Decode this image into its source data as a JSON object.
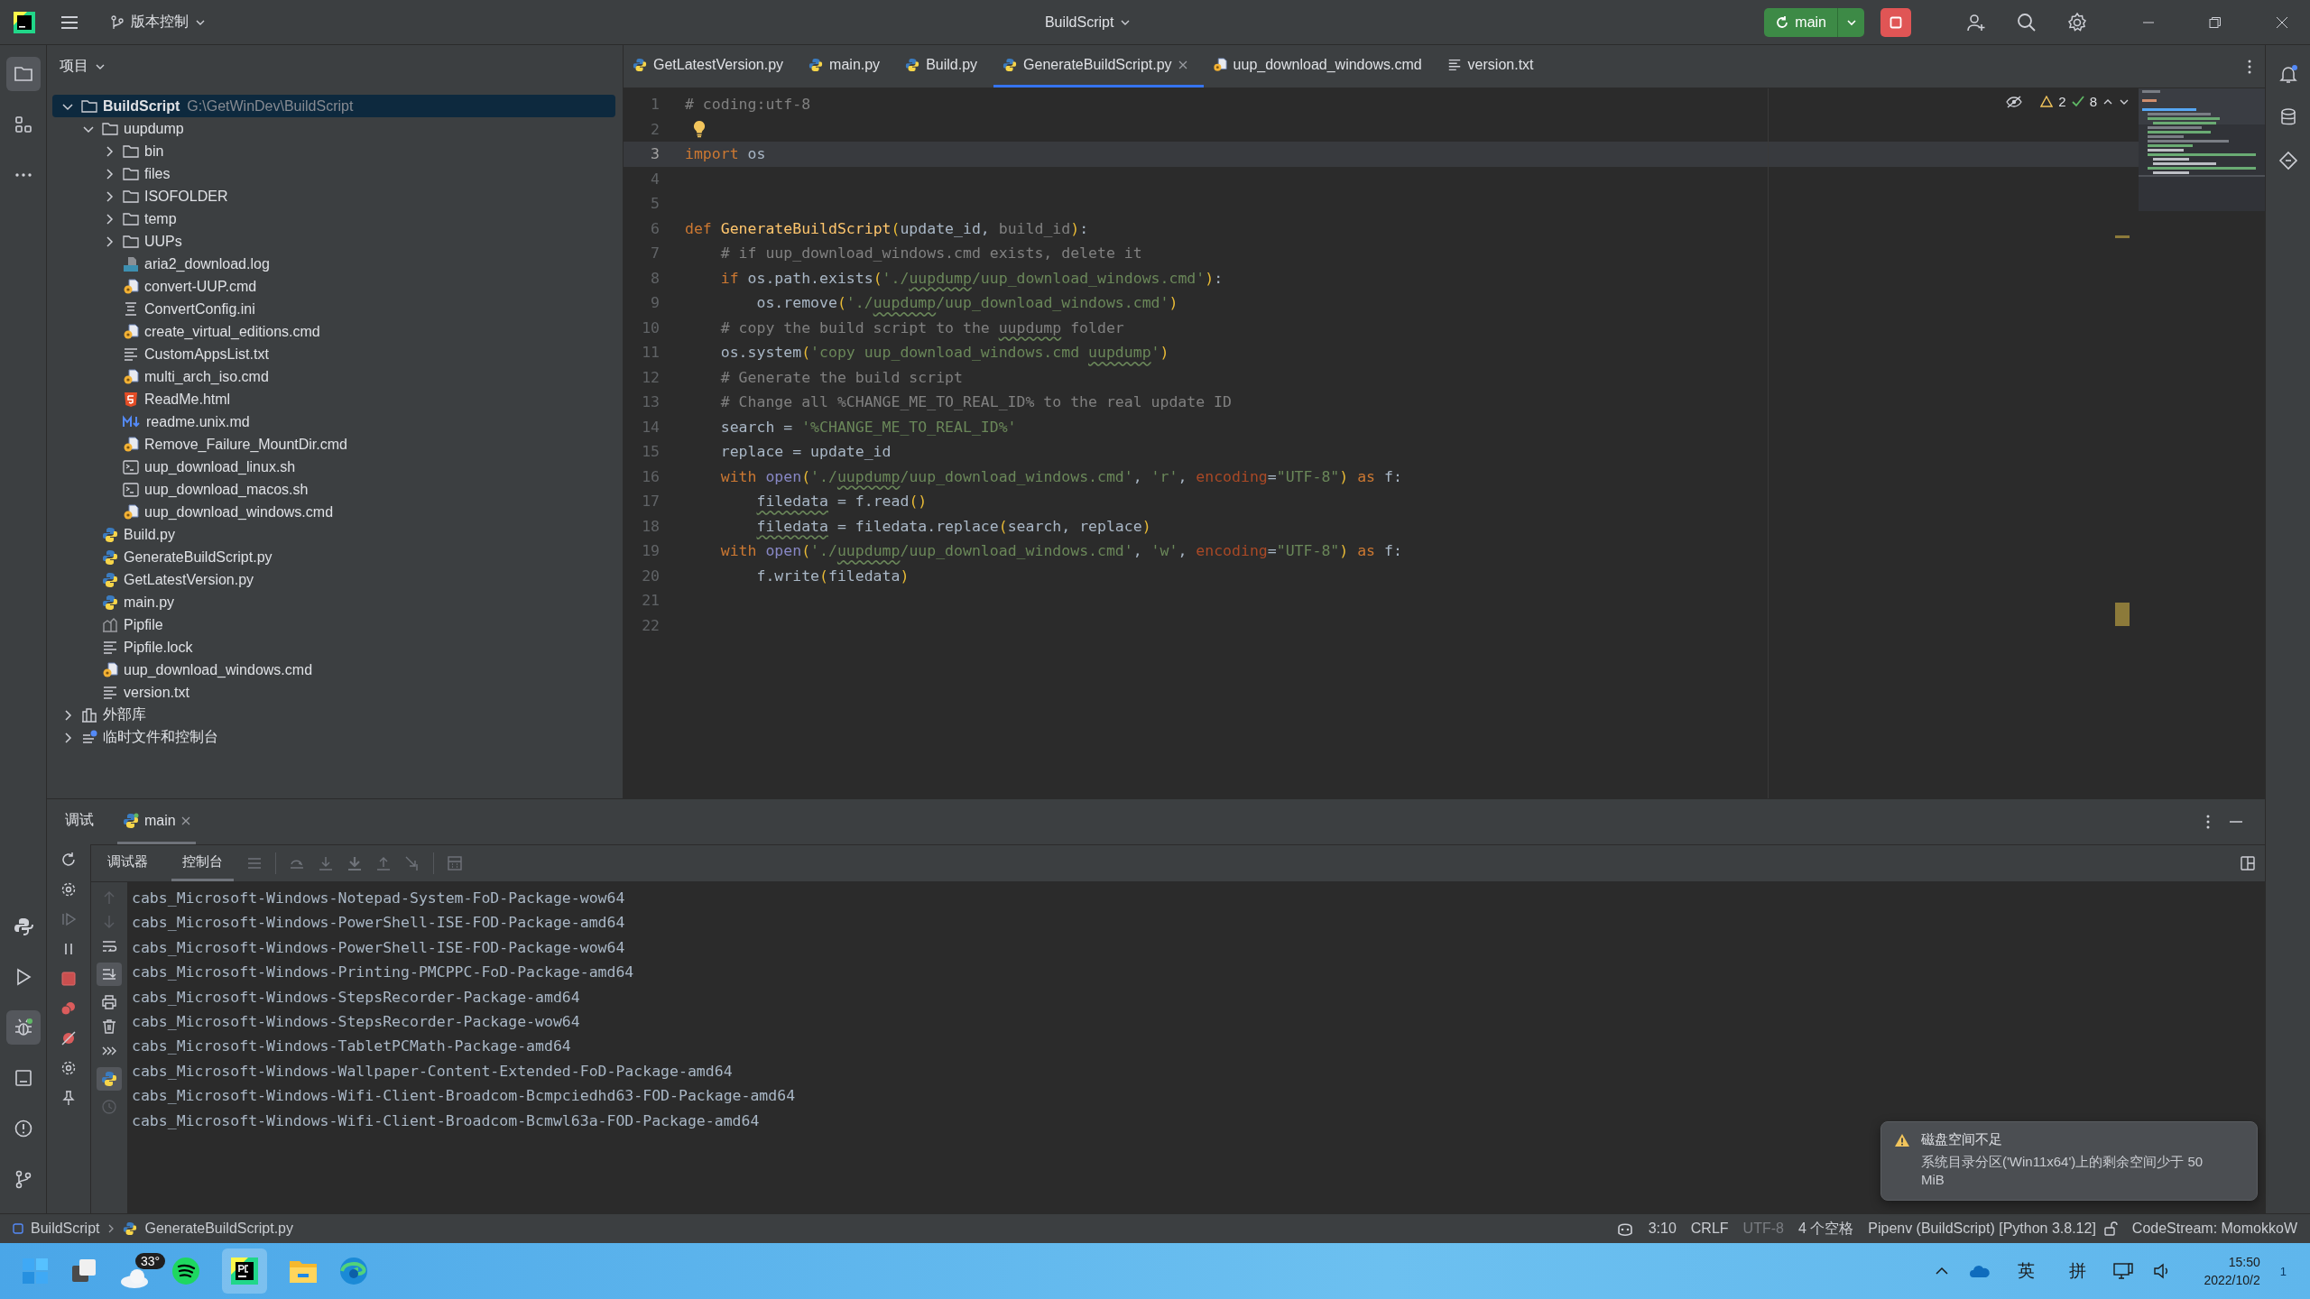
{
  "title_bar": {
    "vcs_label": "版本控制",
    "project": "BuildScript",
    "branch": "main"
  },
  "project_panel": {
    "title": "项目",
    "tree": [
      {
        "label": "BuildScript",
        "path": "G:\\GetWinDev\\BuildScript",
        "kind": "folder",
        "expanded": true,
        "selected": true,
        "children": [
          {
            "label": "uupdump",
            "kind": "folder",
            "expanded": true,
            "selected": false,
            "children": [
              {
                "label": "bin",
                "kind": "folder",
                "expanded": false,
                "selected": false
              },
              {
                "label": "files",
                "kind": "folder",
                "expanded": false,
                "selected": false
              },
              {
                "label": "ISOFOLDER",
                "kind": "folder",
                "expanded": false,
                "selected": false
              },
              {
                "label": "temp",
                "kind": "folder",
                "expanded": false,
                "selected": false
              },
              {
                "label": "UUPs",
                "kind": "folder",
                "expanded": false,
                "selected": false
              },
              {
                "label": "aria2_download.log",
                "kind": "log",
                "selected": false
              },
              {
                "label": "convert-UUP.cmd",
                "kind": "cmd",
                "selected": false
              },
              {
                "label": "ConvertConfig.ini",
                "kind": "ini",
                "selected": false
              },
              {
                "label": "create_virtual_editions.cmd",
                "kind": "cmd",
                "selected": false
              },
              {
                "label": "CustomAppsList.txt",
                "kind": "txt",
                "selected": false
              },
              {
                "label": "multi_arch_iso.cmd",
                "kind": "cmd",
                "selected": false
              },
              {
                "label": "ReadMe.html",
                "kind": "html",
                "selected": false
              },
              {
                "label": "readme.unix.md",
                "kind": "md",
                "selected": false
              },
              {
                "label": "Remove_Failure_MountDir.cmd",
                "kind": "cmd",
                "selected": false
              },
              {
                "label": "uup_download_linux.sh",
                "kind": "sh",
                "selected": false
              },
              {
                "label": "uup_download_macos.sh",
                "kind": "sh",
                "selected": false
              },
              {
                "label": "uup_download_windows.cmd",
                "kind": "cmd",
                "selected": false
              }
            ]
          },
          {
            "label": "Build.py",
            "kind": "py",
            "selected": false
          },
          {
            "label": "GenerateBuildScript.py",
            "kind": "py",
            "selected": false
          },
          {
            "label": "GetLatestVersion.py",
            "kind": "py",
            "selected": false
          },
          {
            "label": "main.py",
            "kind": "py",
            "selected": false
          },
          {
            "label": "Pipfile",
            "kind": "pipfile",
            "selected": false
          },
          {
            "label": "Pipfile.lock",
            "kind": "txt",
            "selected": false
          },
          {
            "label": "uup_download_windows.cmd",
            "kind": "cmd",
            "selected": false
          },
          {
            "label": "version.txt",
            "kind": "txt",
            "selected": false
          }
        ]
      },
      {
        "label": "外部库",
        "kind": "lib",
        "expanded": false,
        "selected": false
      },
      {
        "label": "临时文件和控制台",
        "kind": "scratch",
        "expanded": false,
        "selected": false
      }
    ]
  },
  "editor_tabs": [
    {
      "label": "GetLatestVersion.py",
      "kind": "py",
      "selected": false
    },
    {
      "label": "main.py",
      "kind": "py",
      "selected": false
    },
    {
      "label": "Build.py",
      "kind": "py",
      "selected": false
    },
    {
      "label": "GenerateBuildScript.py",
      "kind": "py",
      "selected": true
    },
    {
      "label": "uup_download_windows.cmd",
      "kind": "cmd",
      "selected": false
    },
    {
      "label": "version.txt",
      "kind": "txt",
      "selected": false
    }
  ],
  "inspections": {
    "warnings": "2",
    "passed": "8"
  },
  "code_lines": [
    {
      "n": "1",
      "current": false,
      "tokens": [
        {
          "kind": "com",
          "text": "# coding:utf-8"
        }
      ]
    },
    {
      "n": "2",
      "current": false,
      "tokens": [
        {
          "kind": "bulb"
        }
      ]
    },
    {
      "n": "3",
      "current": true,
      "tokens": [
        {
          "kind": "kw",
          "text": "import"
        },
        {
          "kind": "plain",
          "text": " os"
        }
      ]
    },
    {
      "n": "4",
      "current": false
    },
    {
      "n": "5",
      "current": false
    },
    {
      "n": "6",
      "current": false,
      "tokens": [
        {
          "kind": "kw",
          "text": "def "
        },
        {
          "kind": "fn",
          "text": "GenerateBuildScript"
        },
        {
          "kind": "brace",
          "text": "("
        },
        {
          "kind": "plain",
          "text": "update_id, "
        },
        {
          "kind": "param",
          "text": "build_id"
        },
        {
          "kind": "brace",
          "text": ")"
        },
        {
          "kind": "plain",
          "text": ":"
        }
      ]
    },
    {
      "n": "7",
      "current": false,
      "tokens": [
        {
          "kind": "com",
          "text": "    # if uup_download_windows.cmd exists, delete it"
        }
      ]
    },
    {
      "n": "8",
      "current": false,
      "tokens": [
        {
          "kind": "kw",
          "text": "    if"
        },
        {
          "kind": "plain",
          "text": " os.path.exists"
        },
        {
          "kind": "brace",
          "text": "("
        },
        {
          "kind": "str",
          "text": "'./"
        },
        {
          "kind": "strtypo",
          "text": "uupdump"
        },
        {
          "kind": "str",
          "text": "/uup_download_windows.cmd'"
        },
        {
          "kind": "brace",
          "text": ")"
        },
        {
          "kind": "plain",
          "text": ":"
        }
      ]
    },
    {
      "n": "9",
      "current": false,
      "tokens": [
        {
          "kind": "plain",
          "text": "        os.remove"
        },
        {
          "kind": "brace",
          "text": "("
        },
        {
          "kind": "str",
          "text": "'./"
        },
        {
          "kind": "strtypo",
          "text": "uupdump"
        },
        {
          "kind": "str",
          "text": "/uup_download_windows.cmd'"
        },
        {
          "kind": "brace",
          "text": ")"
        }
      ]
    },
    {
      "n": "10",
      "current": false,
      "tokens": [
        {
          "kind": "com",
          "text": "    # copy the build script to the "
        },
        {
          "kind": "comtypo",
          "text": "uupdump"
        },
        {
          "kind": "com",
          "text": " folder"
        }
      ]
    },
    {
      "n": "11",
      "current": false,
      "tokens": [
        {
          "kind": "plain",
          "text": "    os.system"
        },
        {
          "kind": "brace",
          "text": "("
        },
        {
          "kind": "str",
          "text": "'copy uup_download_windows.cmd "
        },
        {
          "kind": "strtypo",
          "text": "uupdump"
        },
        {
          "kind": "str",
          "text": "'"
        },
        {
          "kind": "brace",
          "text": ")"
        }
      ]
    },
    {
      "n": "12",
      "current": false,
      "tokens": [
        {
          "kind": "com",
          "text": "    # Generate the build script"
        }
      ]
    },
    {
      "n": "13",
      "current": false,
      "tokens": [
        {
          "kind": "com",
          "text": "    # Change all %CHANGE_ME_TO_REAL_ID% to the real update ID"
        }
      ]
    },
    {
      "n": "14",
      "current": false,
      "tokens": [
        {
          "kind": "plain",
          "text": "    search = "
        },
        {
          "kind": "str",
          "text": "'%CHANGE_ME_TO_REAL_ID%'"
        }
      ]
    },
    {
      "n": "15",
      "current": false,
      "tokens": [
        {
          "kind": "plain",
          "text": "    replace = update_id"
        }
      ]
    },
    {
      "n": "16",
      "current": false,
      "tokens": [
        {
          "kind": "kw",
          "text": "    with "
        },
        {
          "kind": "builtin",
          "text": "open"
        },
        {
          "kind": "brace",
          "text": "("
        },
        {
          "kind": "str",
          "text": "'./"
        },
        {
          "kind": "strtypo",
          "text": "uupdump"
        },
        {
          "kind": "str",
          "text": "/uup_download_windows.cmd'"
        },
        {
          "kind": "plain",
          "text": ", "
        },
        {
          "kind": "str",
          "text": "'r'"
        },
        {
          "kind": "plain",
          "text": ", "
        },
        {
          "kind": "kwarg",
          "text": "encoding"
        },
        {
          "kind": "plain",
          "text": "="
        },
        {
          "kind": "str",
          "text": "\"UTF-8\""
        },
        {
          "kind": "brace",
          "text": ")"
        },
        {
          "kind": "kw",
          "text": " as"
        },
        {
          "kind": "plain",
          "text": " f:"
        }
      ]
    },
    {
      "n": "17",
      "current": false,
      "tokens": [
        {
          "kind": "typo",
          "text": "        filedata"
        },
        {
          "kind": "plain",
          "text": " = f.read"
        },
        {
          "kind": "brace",
          "text": "()"
        }
      ]
    },
    {
      "n": "18",
      "current": false,
      "tokens": [
        {
          "kind": "typo",
          "text": "        filedata"
        },
        {
          "kind": "plain",
          "text": " = filedata.replace"
        },
        {
          "kind": "brace",
          "text": "("
        },
        {
          "kind": "plain",
          "text": "search, replace"
        },
        {
          "kind": "brace",
          "text": ")"
        }
      ]
    },
    {
      "n": "19",
      "current": false,
      "tokens": [
        {
          "kind": "kw",
          "text": "    with "
        },
        {
          "kind": "builtin",
          "text": "open"
        },
        {
          "kind": "brace",
          "text": "("
        },
        {
          "kind": "str",
          "text": "'./"
        },
        {
          "kind": "strtypo",
          "text": "uupdump"
        },
        {
          "kind": "str",
          "text": "/uup_download_windows.cmd'"
        },
        {
          "kind": "plain",
          "text": ", "
        },
        {
          "kind": "str",
          "text": "'w'"
        },
        {
          "kind": "plain",
          "text": ", "
        },
        {
          "kind": "kwarg",
          "text": "encoding"
        },
        {
          "kind": "plain",
          "text": "="
        },
        {
          "kind": "str",
          "text": "\"UTF-8\""
        },
        {
          "kind": "brace",
          "text": ")"
        },
        {
          "kind": "kw",
          "text": " as"
        },
        {
          "kind": "plain",
          "text": " f:"
        }
      ]
    },
    {
      "n": "20",
      "current": false,
      "tokens": [
        {
          "kind": "plain",
          "text": "        f.write"
        },
        {
          "kind": "brace",
          "text": "("
        },
        {
          "kind": "plain",
          "text": "filedata"
        },
        {
          "kind": "brace",
          "text": ")"
        }
      ]
    },
    {
      "n": "21",
      "current": false
    },
    {
      "n": "22",
      "current": false
    }
  ],
  "debug_panel": {
    "tabs": [
      {
        "label": "调试",
        "selected": false
      },
      {
        "label": "main",
        "selected": true
      }
    ],
    "subtabs": [
      {
        "label": "调试器",
        "selected": false
      },
      {
        "label": "控制台",
        "selected": true
      }
    ],
    "console": [
      "cabs_Microsoft-Windows-Notepad-System-FoD-Package-wow64",
      "cabs_Microsoft-Windows-PowerShell-ISE-FOD-Package-amd64",
      "cabs_Microsoft-Windows-PowerShell-ISE-FOD-Package-wow64",
      "cabs_Microsoft-Windows-Printing-PMCPPC-FoD-Package-amd64",
      "cabs_Microsoft-Windows-StepsRecorder-Package-amd64",
      "cabs_Microsoft-Windows-StepsRecorder-Package-wow64",
      "cabs_Microsoft-Windows-TabletPCMath-Package-amd64",
      "cabs_Microsoft-Windows-Wallpaper-Content-Extended-FoD-Package-amd64",
      "cabs_Microsoft-Windows-Wifi-Client-Broadcom-Bcmpciedhd63-FOD-Package-amd64",
      "cabs_Microsoft-Windows-Wifi-Client-Broadcom-Bcmwl63a-FOD-Package-amd64"
    ]
  },
  "notification": {
    "title": "磁盘空间不足",
    "body": "系统目录分区('Win11x64')上的剩余空间少于 50 MiB"
  },
  "status_bar": {
    "breadcrumb": [
      "BuildScript",
      "GenerateBuildScript.py"
    ],
    "items": [
      {
        "text": "3:10",
        "disabled": false
      },
      {
        "text": "CRLF",
        "disabled": false
      },
      {
        "text": "UTF-8",
        "disabled": true
      },
      {
        "text": "4 个空格",
        "disabled": false
      },
      {
        "text": "Pipenv (BuildScript) [Python 3.8.12]",
        "disabled": false
      },
      {
        "text": "CodeStream:  MomokkoW",
        "disabled": false
      }
    ]
  },
  "taskbar": {
    "weather": "33°",
    "ime": [
      "英",
      "拼"
    ],
    "time": "15:50",
    "date": "2022/10/2",
    "notification_count": "1"
  }
}
